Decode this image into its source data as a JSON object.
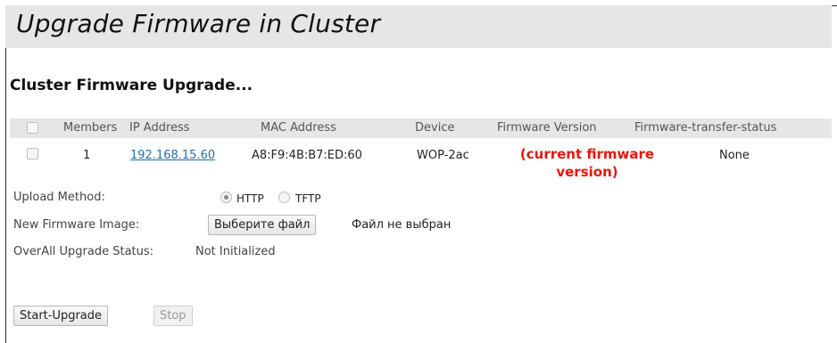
{
  "page": {
    "title": "Upgrade Firmware in Cluster"
  },
  "section": {
    "title": "Cluster Firmware Upgrade..."
  },
  "table": {
    "headers": {
      "members": "Members",
      "ip_address": "IP Address",
      "mac_address": "MAC Address",
      "device": "Device",
      "firmware_version": "Firmware Version",
      "transfer_status": "Firmware-transfer-status"
    },
    "rows": [
      {
        "members": "1",
        "ip_address": "192.168.15.60",
        "mac_address": "A8:F9:4B:B7:ED:60",
        "device": "WOP-2ac",
        "firmware_version_line1": "(current firmware",
        "firmware_version_line2": "version)",
        "transfer_status": "None"
      }
    ]
  },
  "upload": {
    "label": "Upload Method:",
    "options": [
      "HTTP",
      "TFTP"
    ],
    "selected": "HTTP"
  },
  "image": {
    "label": "New Firmware Image:",
    "choose_button": "Выберите файл",
    "file_status": "Файл не выбран"
  },
  "status": {
    "label": "OverAll Upgrade Status:",
    "value": "Not Initialized"
  },
  "actions": {
    "start": "Start-Upgrade",
    "stop": "Stop"
  }
}
